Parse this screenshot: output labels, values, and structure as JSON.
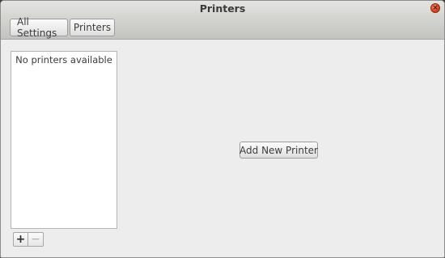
{
  "window": {
    "title": "Printers",
    "close_glyph": "×"
  },
  "nav": {
    "all_settings_label": "All Settings",
    "printers_label": "Printers"
  },
  "printer_list": {
    "empty_text": "No printers available"
  },
  "list_toolbar": {
    "add_label": "+",
    "remove_label": "−"
  },
  "main": {
    "add_printer_label": "Add New Printer"
  },
  "colors": {
    "close_button": "#e1461d",
    "window_background": "#ededed",
    "titlebar": "#d4d4d1"
  }
}
